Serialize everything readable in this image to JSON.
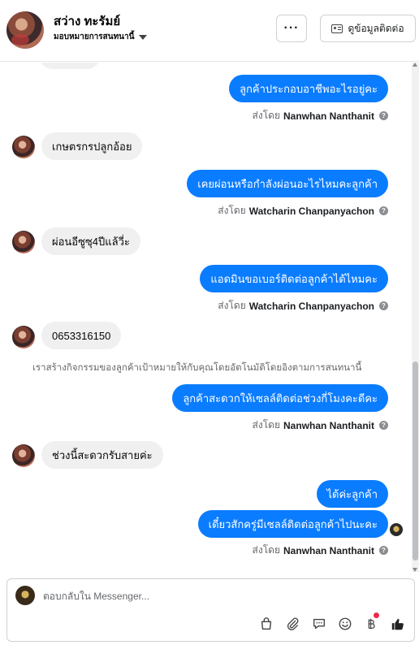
{
  "header": {
    "contact_name": "สว่าง ทะรัมย์",
    "assign_label": "มอบหมายการสนทนานี้",
    "more_label": "···",
    "contact_info_label": "ดูข้อมูลติดต่อ"
  },
  "messages": [
    {
      "text": "ลูกค้าประกอบอาชีพอะไรอยู่คะ",
      "direction": "out"
    },
    {
      "text": "เกษตรกรปลูกอ้อย",
      "direction": "in"
    },
    {
      "text": "เคยผ่อนหรือกำลังผ่อนอะไรไหมคะลูกค้า",
      "direction": "out"
    },
    {
      "text": "ผ่อนอีซูซุ4ปีแล้วี่ะ",
      "direction": "in"
    },
    {
      "text": "แอดมินขอเบอร์ติดต่อลูกค้าได้ไหมคะ",
      "direction": "out"
    },
    {
      "text": "0653316150",
      "direction": "in"
    },
    {
      "text": "ลูกค้าสะดวกให้เซลล์ติดต่อช่วงกี่โมงคะดีคะ",
      "direction": "out"
    },
    {
      "text": "ช่วงนี้สะดวกรับสายค่ะ",
      "direction": "in"
    },
    {
      "text": "ได้ค่ะลูกค้า",
      "direction": "out"
    },
    {
      "text": "เดี๋ยวสักครู่มีเซลล์ติดต่อลูกค้าไปนะคะ",
      "direction": "out"
    }
  ],
  "sent_by": [
    {
      "prefix": "ส่งโดย",
      "name": "Nanwhan Nanthanit"
    },
    {
      "prefix": "ส่งโดย",
      "name": "Watcharin Chanpanyachon"
    },
    {
      "prefix": "ส่งโดย",
      "name": "Watcharin Chanpanyachon"
    },
    {
      "prefix": "ส่งโดย",
      "name": "Nanwhan Nanthanit"
    },
    {
      "prefix": "ส่งโดย",
      "name": "Nanwhan Nanthanit"
    }
  ],
  "help_glyph": "?",
  "system_note": "เราสร้างกิจกรรมของลูกค้าเป้าหมายให้กับคุณโดยอัตโนมัติโดยอิงตามการสนทนานี้",
  "composer": {
    "placeholder": "ตอบกลับใน Messenger..."
  },
  "toolbar_icons": [
    "shopping-bag-icon",
    "paperclip-icon",
    "chat-bubble-icon",
    "emoji-icon",
    "baht-icon",
    "thumbs-up-icon"
  ],
  "colors": {
    "outgoing_bubble": "#0a7cff",
    "incoming_bubble": "#f0f0f0",
    "notification_dot": "#f02849"
  }
}
